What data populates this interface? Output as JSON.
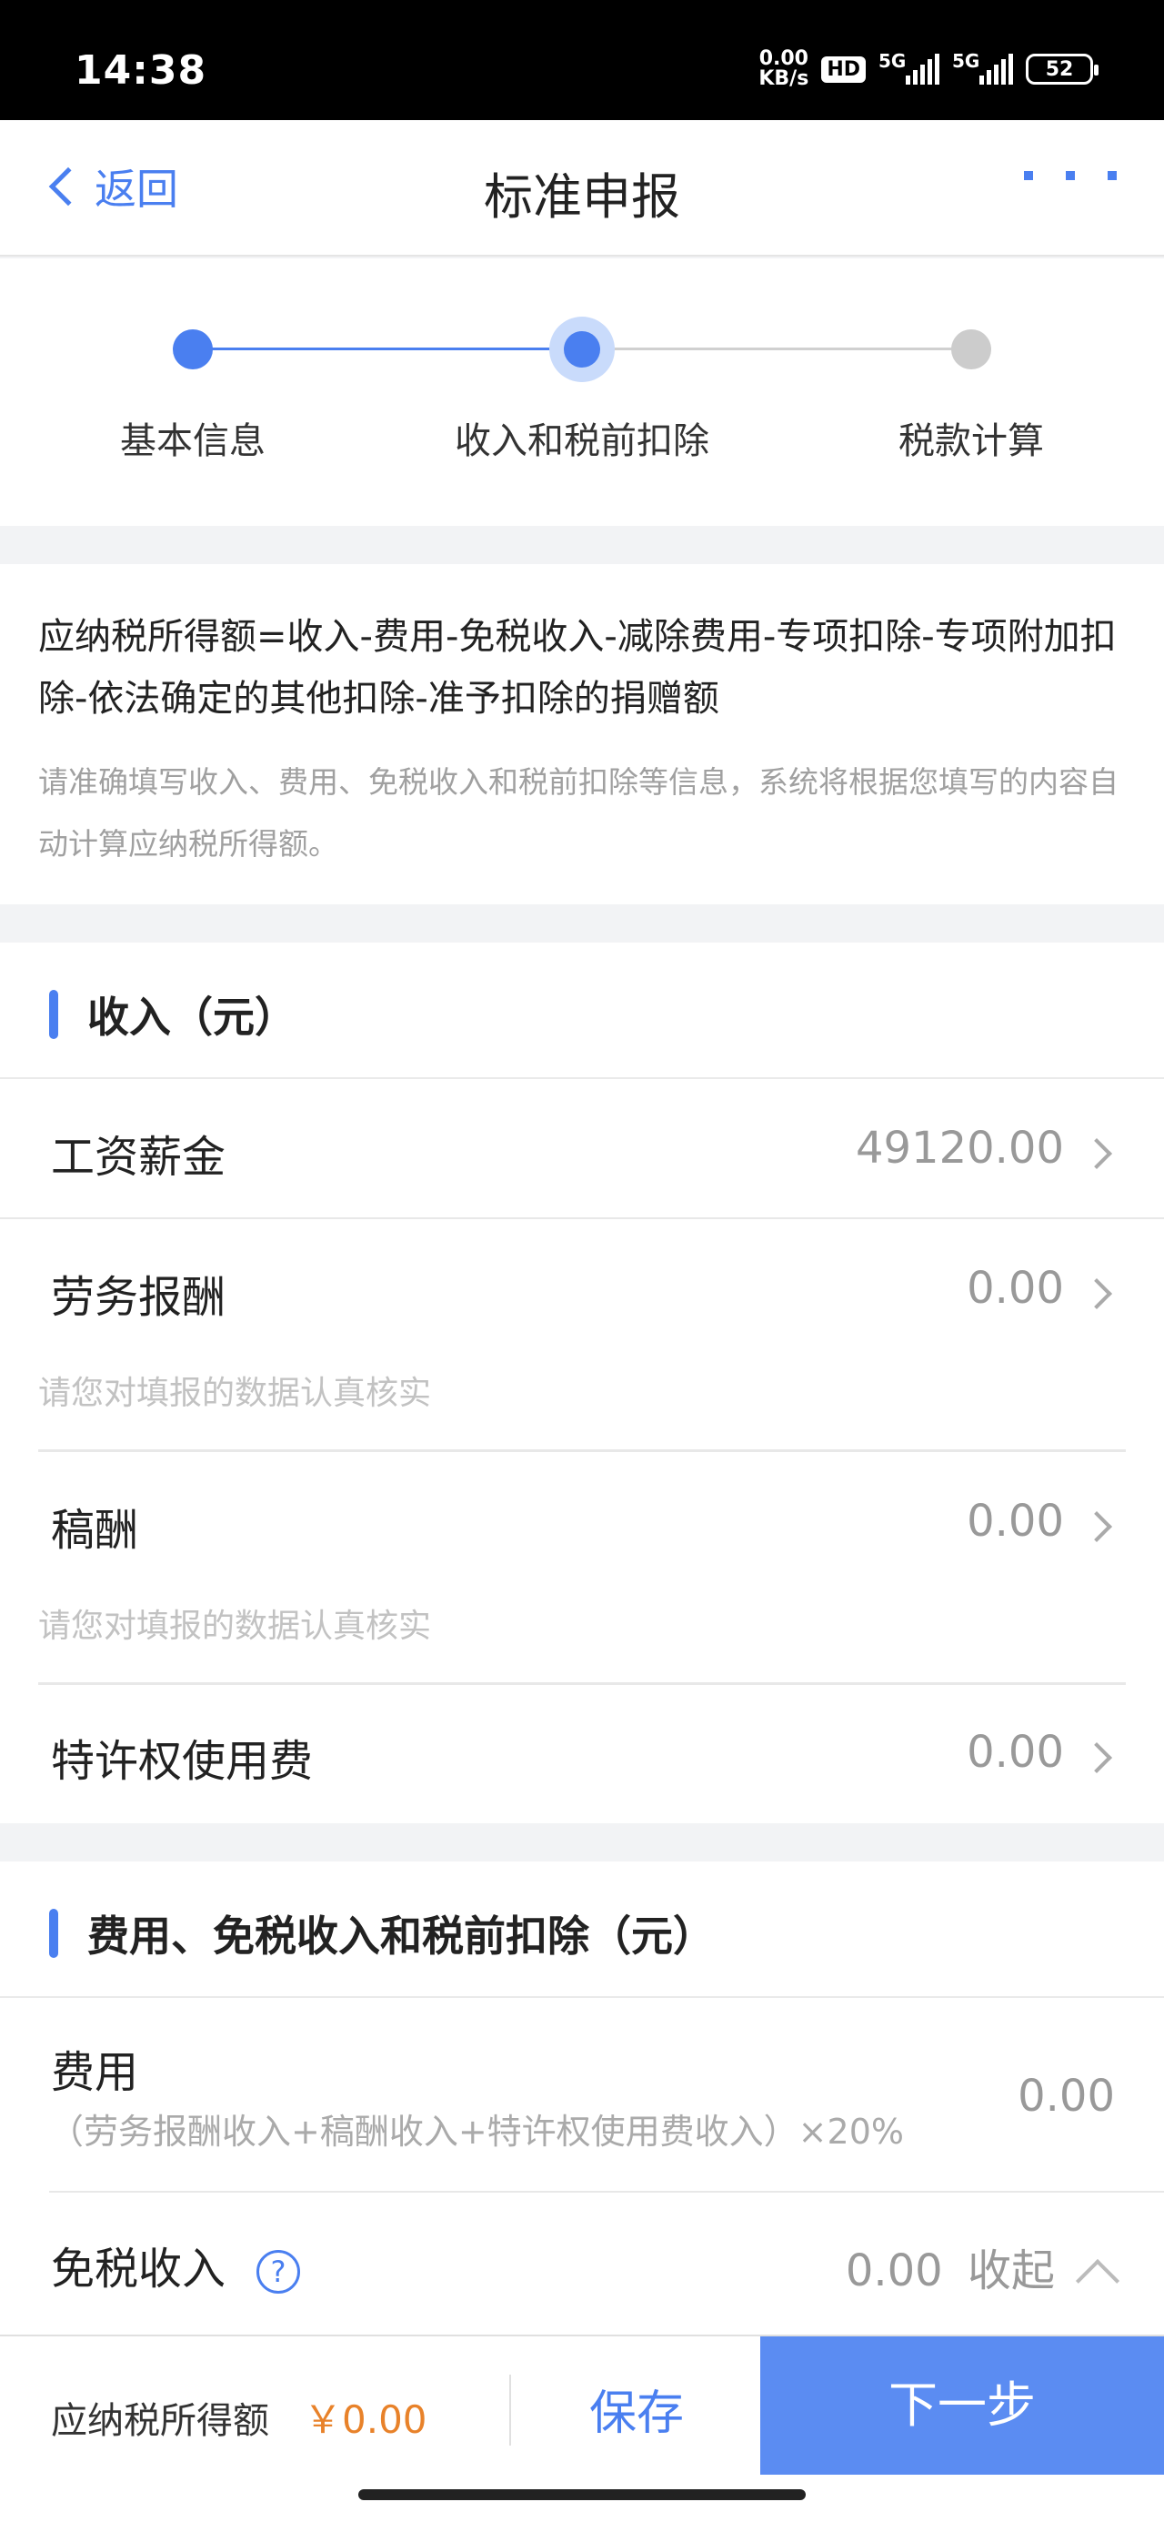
{
  "status_bar": {
    "time": "14:38",
    "net_speed_value": "0.00",
    "net_speed_unit": "KB/s",
    "hd_badge": "HD",
    "signal1": "5G",
    "signal2": "5G",
    "battery": "52"
  },
  "nav": {
    "back_label": "返回",
    "title": "标准申报"
  },
  "stepper": {
    "steps": [
      {
        "label": "基本信息",
        "state": "done"
      },
      {
        "label": "收入和税前扣除",
        "state": "current"
      },
      {
        "label": "税款计算",
        "state": "pending"
      }
    ],
    "colors": {
      "active": "#4a7ff0",
      "inactive": "#cccccc",
      "halo": "#c9dbfb"
    }
  },
  "formula": {
    "text": "应纳税所得额=收入-费用-免税收入-减除费用-专项扣除-专项附加扣除-依法确定的其他扣除-准予扣除的捐赠额",
    "hint": "请准确填写收入、费用、免税收入和税前扣除等信息，系统将根据您填写的内容自动计算应纳税所得额。"
  },
  "income_section": {
    "title": "收入（元）",
    "rows": [
      {
        "label": "工资薪金",
        "value": "49120.00"
      },
      {
        "label": "劳务报酬",
        "value": "0.00",
        "hint": "请您对填报的数据认真核实"
      },
      {
        "label": "稿酬",
        "value": "0.00",
        "hint": "请您对填报的数据认真核实"
      },
      {
        "label": "特许权使用费",
        "value": "0.00"
      }
    ]
  },
  "deduction_section": {
    "title": "费用、免税收入和税前扣除（元）",
    "expense_label": "费用",
    "expense_formula": "（劳务报酬收入+稿酬收入+特许权使用费收入）×20%",
    "expense_value": "0.00",
    "tax_free_label": "免税收入",
    "help_icon": "?",
    "tax_free_value": "0.00",
    "collapse_label": "收起"
  },
  "bottom_bar": {
    "label": "应纳税所得额",
    "amount": "￥0.00",
    "save_label": "保存",
    "next_label": "下一步",
    "accent_color": "#5b8cf2",
    "amount_color": "#e8822a"
  }
}
